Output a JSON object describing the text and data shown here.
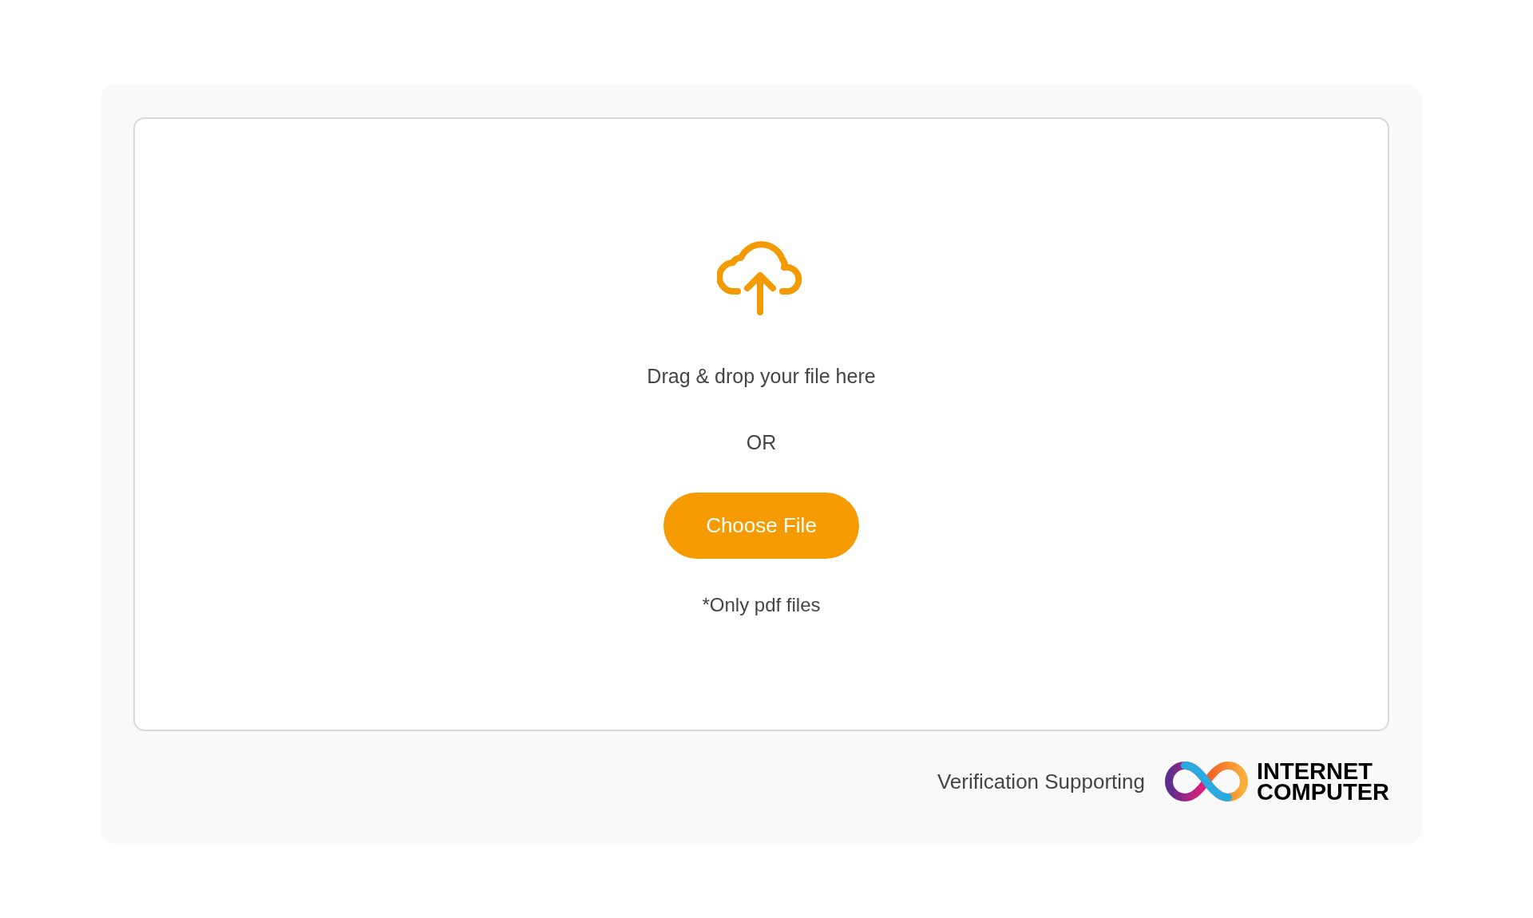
{
  "dropzone": {
    "instruction": "Drag & drop your file here",
    "separator": "OR",
    "button": "Choose File",
    "note": "*Only pdf files"
  },
  "footer": {
    "label": "Verification Supporting",
    "logo_lines": [
      "INTERNET",
      "COMPUTER"
    ]
  }
}
